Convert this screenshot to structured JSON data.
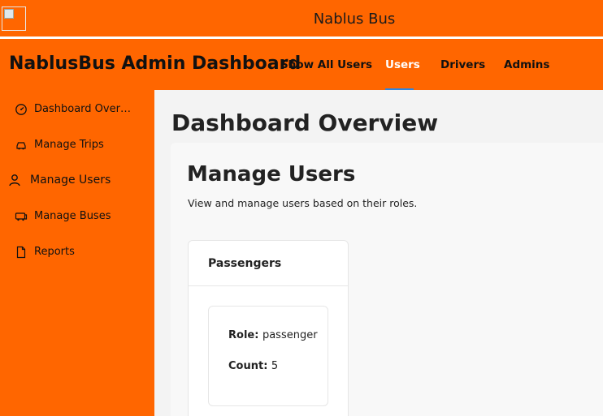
{
  "topbar": {
    "title": "Nablus Bus"
  },
  "header": {
    "brand": "NablusBus Admin Dashboard",
    "nav": [
      {
        "label": "Show All Users"
      },
      {
        "label": "Users"
      },
      {
        "label": "Drivers"
      },
      {
        "label": "Admins"
      }
    ]
  },
  "sidebar": {
    "items": [
      {
        "label": "Dashboard Overview",
        "icon": "gauge-icon"
      },
      {
        "label": "Manage Trips",
        "icon": "car-icon"
      },
      {
        "label": "Manage Users",
        "icon": "user-icon"
      },
      {
        "label": "Manage Buses",
        "icon": "bus-icon"
      },
      {
        "label": "Reports",
        "icon": "document-icon"
      }
    ]
  },
  "main": {
    "title": "Dashboard Overview",
    "panel": {
      "title": "Manage Users",
      "description": "View and manage users based on their roles.",
      "card": {
        "title": "Passengers",
        "role_label": "Role:",
        "role_value": "passenger",
        "count_label": "Count:",
        "count_value": "5"
      }
    }
  },
  "colors": {
    "brand": "#ff6600",
    "active_underline": "#2f86e0"
  }
}
